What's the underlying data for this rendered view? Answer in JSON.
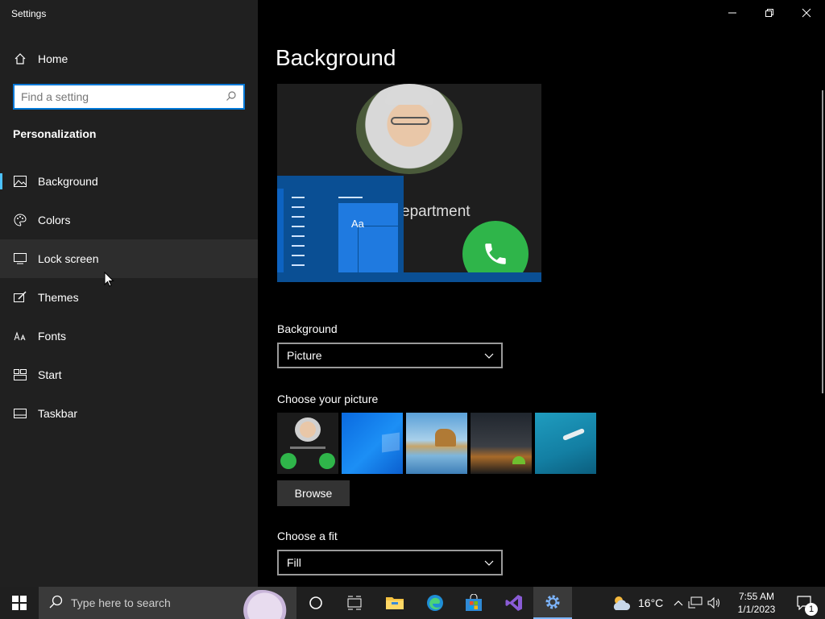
{
  "window": {
    "title": "Settings",
    "minimize_icon": "minimize-icon",
    "restore_icon": "restore-icon",
    "close_icon": "close-icon"
  },
  "nav": {
    "home_label": "Home",
    "search_placeholder": "Find a setting",
    "section_heading": "Personalization",
    "items": [
      {
        "label": "Background",
        "icon": "picture-icon",
        "selected": true
      },
      {
        "label": "Colors",
        "icon": "palette-icon"
      },
      {
        "label": "Lock screen",
        "icon": "lock-screen-icon",
        "hovered": true
      },
      {
        "label": "Themes",
        "icon": "themes-brush-icon"
      },
      {
        "label": "Fonts",
        "icon": "fonts-icon"
      },
      {
        "label": "Start",
        "icon": "start-layout-icon"
      },
      {
        "label": "Taskbar",
        "icon": "taskbar-icon"
      }
    ]
  },
  "main": {
    "page_title": "Background",
    "preview": {
      "department_text": "epartment",
      "sample_text": "Aa"
    },
    "background_label": "Background",
    "background_value": "Picture",
    "choose_picture_label": "Choose your picture",
    "browse_label": "Browse",
    "choose_fit_label": "Choose a fit",
    "fit_value": "Fill"
  },
  "taskbar": {
    "search_text": "Type here to search",
    "apps": [
      "task-view-icon",
      "file-explorer-icon",
      "edge-icon",
      "microsoft-store-icon",
      "visual-studio-icon",
      "settings-gear-icon"
    ],
    "temperature": "16°C",
    "time": "7:55 AM",
    "date": "1/1/2023",
    "notification_count": "1"
  },
  "colors": {
    "accent": "#0078d7",
    "nav_bg": "#202020",
    "main_bg": "#000000",
    "taskbar_bg": "#1f1f1f"
  }
}
